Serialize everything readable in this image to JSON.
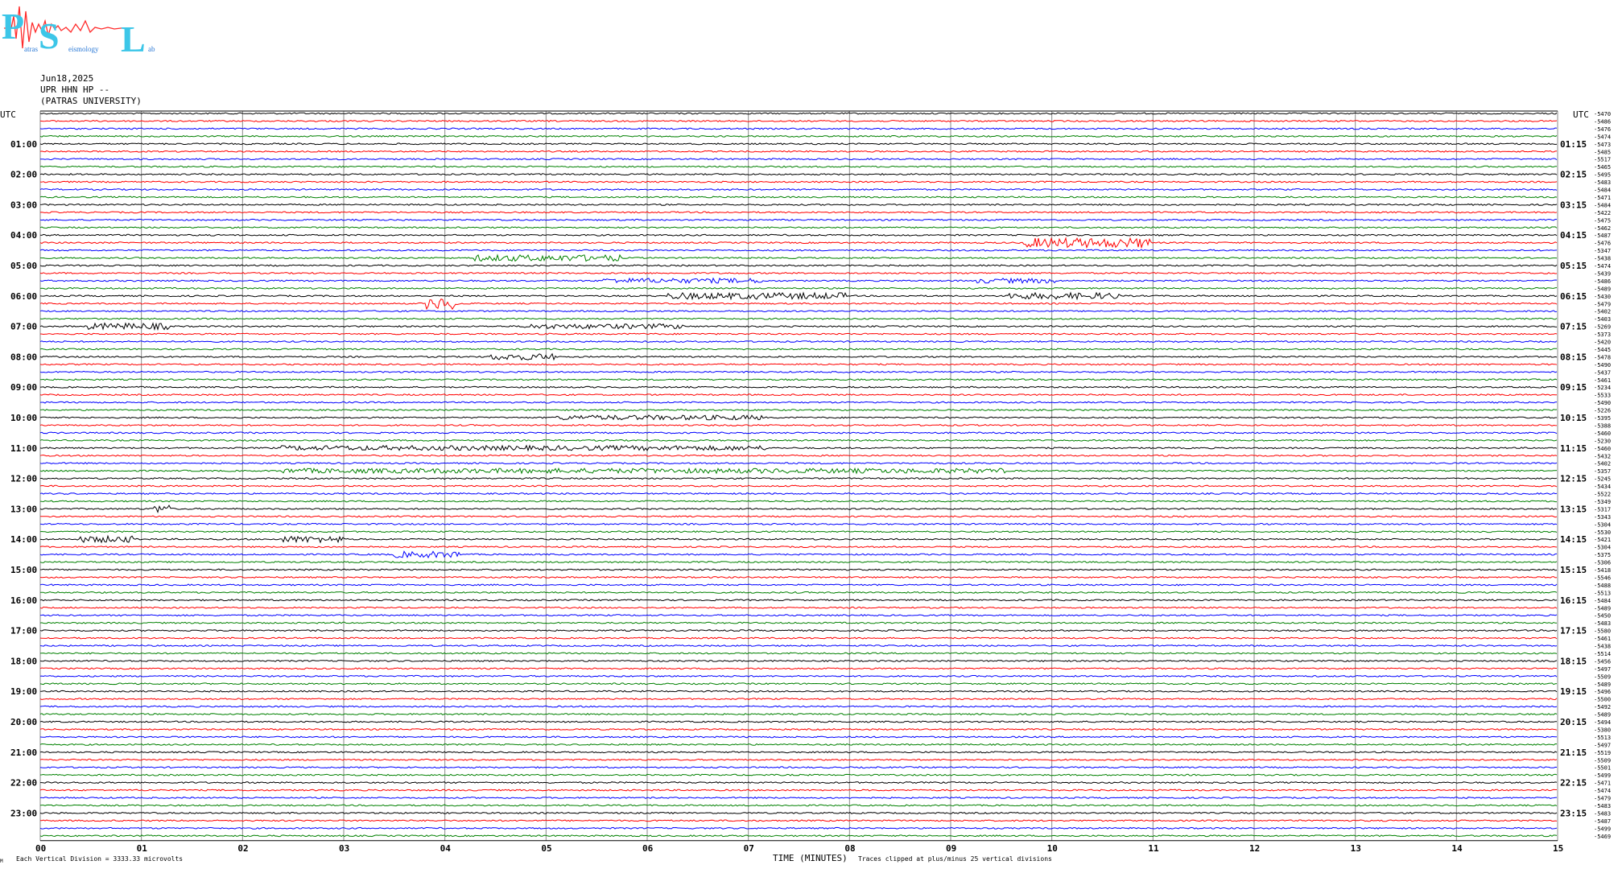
{
  "logo": {
    "letters": "PSL",
    "small_text": [
      "atras",
      "eismology",
      "ab"
    ]
  },
  "header": {
    "date": "Jun18,2025",
    "station": "UPR HHN HP --",
    "org": "(PATRAS UNIVERSITY)"
  },
  "chart_data": {
    "type": "line",
    "title": "",
    "utc_left": "UTC",
    "utc_right": "UTC",
    "left_hour_labels": [
      "01:00",
      "02:00",
      "03:00",
      "04:00",
      "05:00",
      "06:00",
      "07:00",
      "08:00",
      "09:00",
      "10:00",
      "11:00",
      "12:00",
      "13:00",
      "14:00",
      "15:00",
      "16:00",
      "17:00",
      "18:00",
      "19:00",
      "20:00",
      "21:00",
      "22:00",
      "23:00"
    ],
    "right_hour_labels": [
      "01:15",
      "02:15",
      "03:15",
      "04:15",
      "05:15",
      "06:15",
      "07:15",
      "08:15",
      "09:15",
      "10:15",
      "11:15",
      "12:15",
      "13:15",
      "14:15",
      "15:15",
      "16:15",
      "17:15",
      "18:15",
      "19:15",
      "20:15",
      "21:15",
      "22:15",
      "23:15"
    ],
    "xlabel": "TIME (MINUTES)",
    "x_ticks": [
      "00",
      "01",
      "02",
      "03",
      "04",
      "05",
      "06",
      "07",
      "08",
      "09",
      "10",
      "11",
      "12",
      "13",
      "14",
      "15"
    ],
    "xlim": [
      0,
      15
    ],
    "trace_count": 96,
    "trace_colors": [
      "#000000",
      "#ff0000",
      "#0000ff",
      "#008000"
    ],
    "right_offsets": [
      "-5470",
      "-5486",
      "-5476",
      "-5474",
      "-5473",
      "-5485",
      "-5517",
      "-5465",
      "-5495",
      "-5483",
      "-5484",
      "-5471",
      "-5484",
      "-5422",
      "-5475",
      "-5462",
      "-5487",
      "-5476",
      "-5347",
      "-5438",
      "-5474",
      "-5439",
      "-5486",
      "-5489",
      "-5430",
      "-5479",
      "-5402",
      "-5403",
      "-5269",
      "-5373",
      "-5420",
      "-5445",
      "-5478",
      "-5490",
      "-5437",
      "-5461",
      "-5234",
      "-5533",
      "-5490",
      "-5226",
      "-5395",
      "-5388",
      "-5460",
      "-5230",
      "-5460",
      "-5432",
      "-5402",
      "-5357",
      "-5245",
      "-5434",
      "-5522",
      "-5349",
      "-5317",
      "-5343",
      "-5304",
      "-5530",
      "-5421",
      "-5304",
      "-5375",
      "-5306",
      "-5418",
      "-5546",
      "-5488",
      "-5513",
      "-5484",
      "-5489",
      "-5450",
      "-5483",
      "-5580",
      "-5461",
      "-5438",
      "-5514",
      "-5456",
      "-5497",
      "-5509",
      "-5489",
      "-5496",
      "-5500",
      "-5492",
      "-5489",
      "-5494",
      "-5380",
      "-5513",
      "-5497",
      "-5519",
      "-5509",
      "-5501",
      "-5499",
      "-5471",
      "-5474",
      "-5479",
      "-5483",
      "-5483",
      "-5487",
      "-5499",
      "-5469"
    ],
    "footer_left": "Each Vertical Division = 3333.33 microvolts",
    "footer_right": "Traces clipped at plus/minus 25 vertical divisions",
    "corner_mark": "M"
  }
}
